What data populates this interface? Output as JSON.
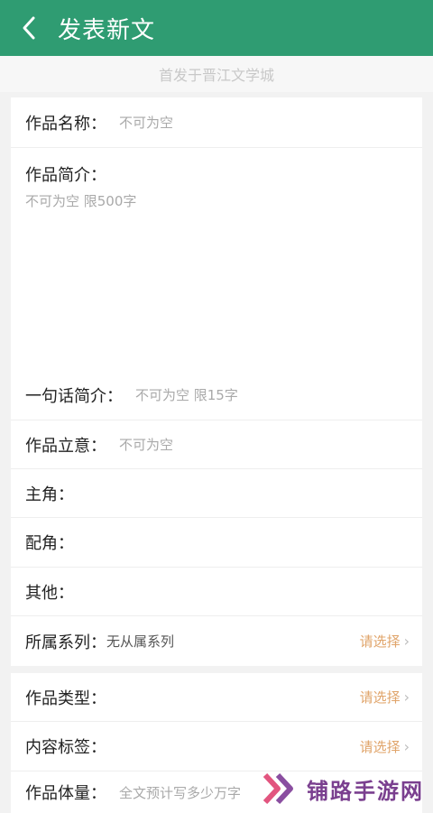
{
  "header": {
    "title": "发表新文",
    "back_icon": "chevron-left-icon"
  },
  "subtitle": "首发于晋江文学城",
  "form1": {
    "work_name": {
      "label": "作品名称：",
      "placeholder": "不可为空"
    },
    "intro": {
      "label": "作品简介：",
      "placeholder": "不可为空 限500字"
    },
    "one_line": {
      "label": "一句话简介：",
      "placeholder": "不可为空 限15字"
    },
    "concept": {
      "label": "作品立意：",
      "placeholder": "不可为空"
    },
    "protagonist": {
      "label": "主角："
    },
    "supporting": {
      "label": "配角："
    },
    "other": {
      "label": "其他："
    },
    "series": {
      "label": "所属系列：",
      "value": "无从属系列",
      "action": "请选择"
    }
  },
  "form2": {
    "type": {
      "label": "作品类型：",
      "action": "请选择"
    },
    "tags": {
      "label": "内容标签：",
      "action": "请选择"
    },
    "volume": {
      "label": "作品体量：",
      "placeholder": "全文预计写多少万字"
    }
  },
  "watermark": {
    "text": "铺路手游网",
    "logo_icon": "play-chevrons-logo"
  },
  "colors": {
    "header": "#2f9c72",
    "accent": "#e0a46a",
    "watermark": "#7a3f8f"
  }
}
